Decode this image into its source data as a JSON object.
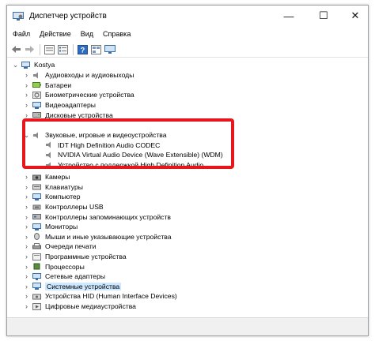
{
  "window": {
    "title": "Диспетчер устройств",
    "buttons": {
      "minimize": "—",
      "maximize": "☐",
      "close": "✕"
    }
  },
  "menu": [
    "Файл",
    "Действие",
    "Вид",
    "Справка"
  ],
  "toolbar": [
    "back-icon",
    "forward-icon",
    "properties-icon",
    "device-list-icon",
    "help-icon",
    "view-icon",
    "monitor-icon"
  ],
  "tree": {
    "root": "Kostya",
    "categories": [
      "Аудиовходы и аудиовыходы",
      "Батареи",
      "Биометрические устройства",
      "Видеоадаптеры",
      "Дисковые устройства",
      "Звуковые, игровые и видеоустройства",
      "IDT High Definition Audio CODEC",
      "NVIDIA Virtual Audio Device (Wave Extensible) (WDM)",
      "Устройство с поддержкой High Definition Audio",
      "Камеры",
      "Клавиатуры",
      "Компьютер",
      "Контроллеры USB",
      "Контроллеры запоминающих устройств",
      "Мониторы",
      "Мыши и иные указывающие устройства",
      "Очереди печати",
      "Программные устройства",
      "Процессоры",
      "Сетевые адаптеры",
      "Системные устройства",
      "Устройства HID (Human Interface Devices)",
      "Цифровые медиаустройства"
    ]
  },
  "colors": {
    "highlight": "#e6161b",
    "selection": "#cde8ff"
  }
}
